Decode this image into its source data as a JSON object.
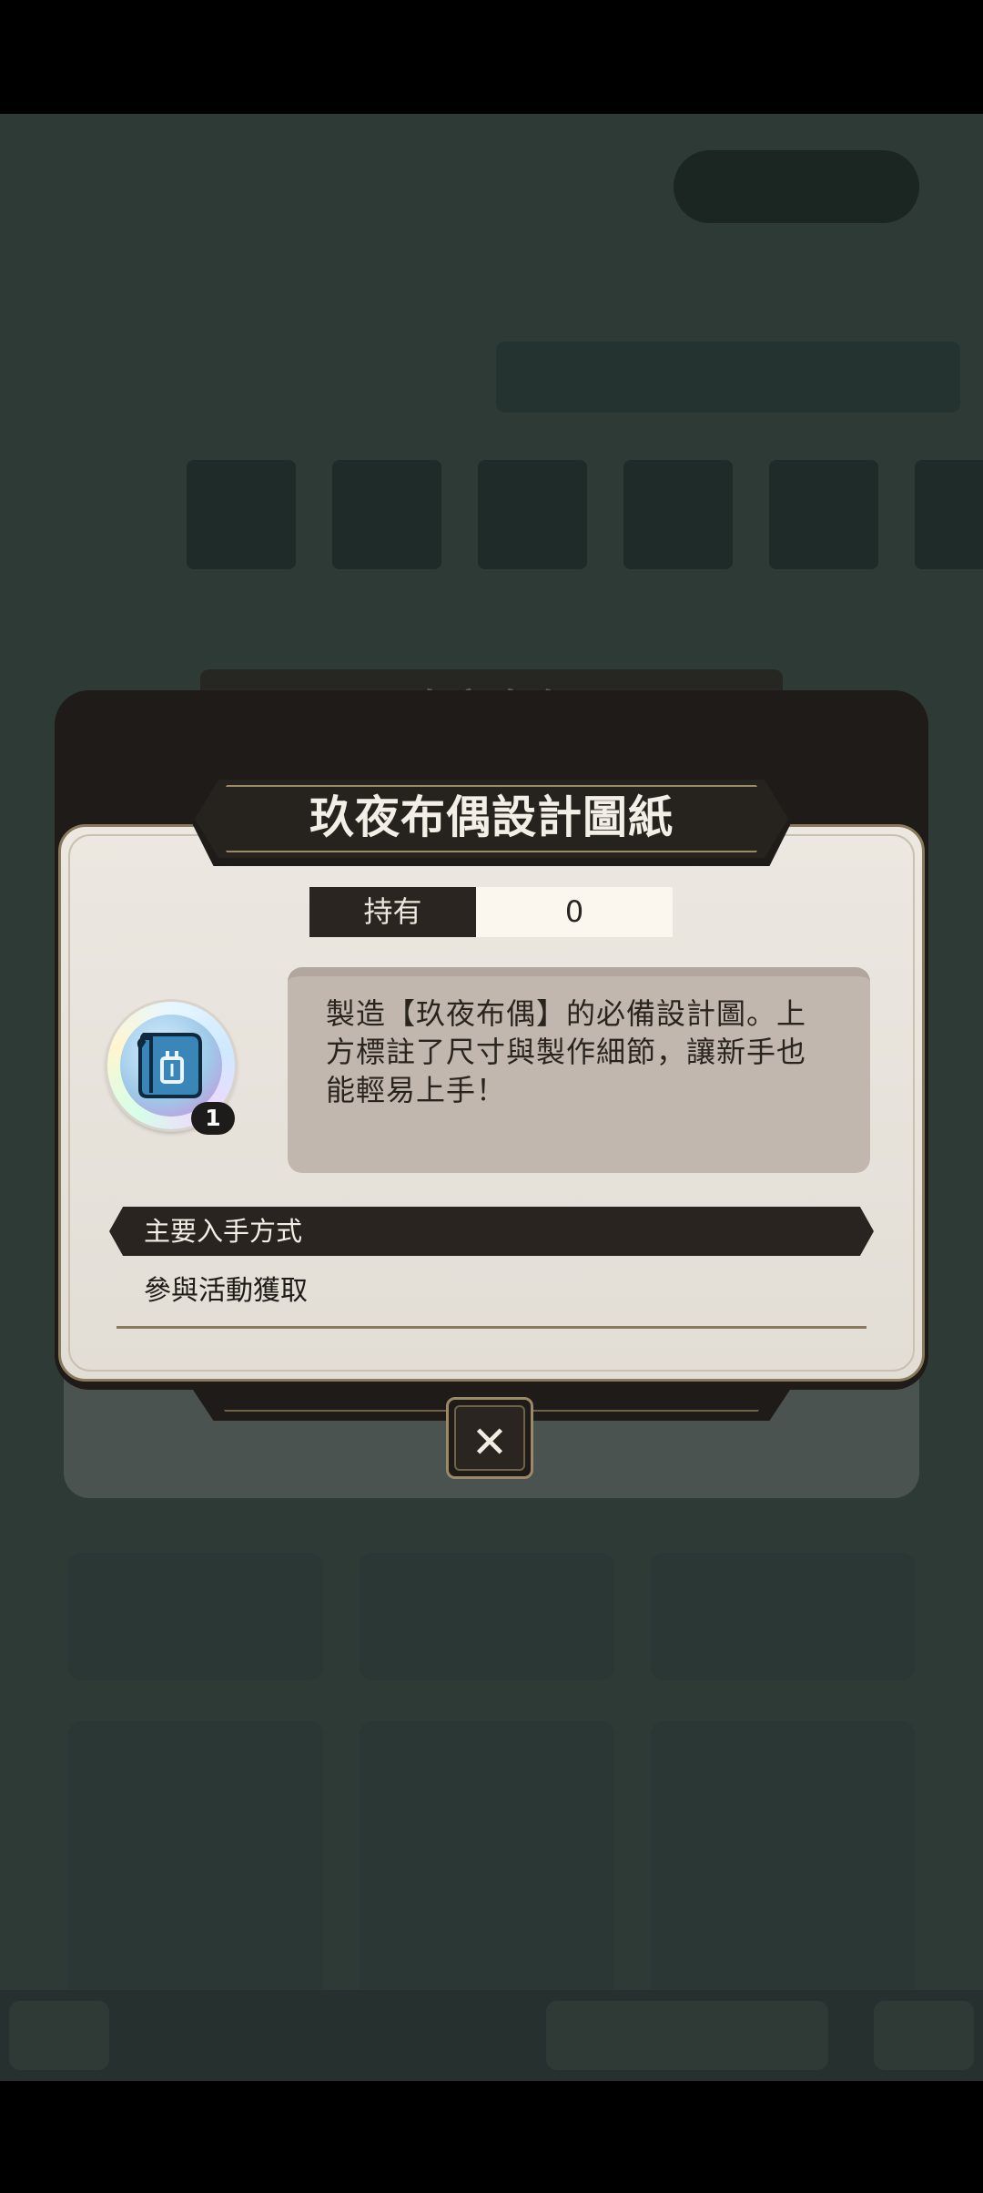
{
  "dialog": {
    "title": "玖夜布偶設計圖紙",
    "hold_label": "持有",
    "hold_value": "0",
    "item_icon": "blueprint-scroll-icon",
    "item_count": "1",
    "description": "製造【玖夜布偶】的必備設計圖。上方標註了尺寸與製作細節，讓新手也能輕易上手！",
    "method_title": "主要入手方式",
    "method_item": "參與活動獲取",
    "close_icon": "close-icon"
  },
  "background": {
    "panel_title": "玖夜布偶"
  }
}
